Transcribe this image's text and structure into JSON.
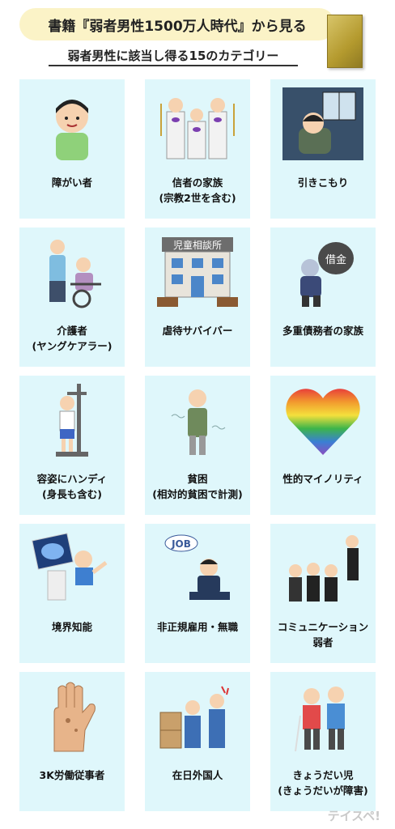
{
  "header": {
    "title": "書籍『弱者男性1500万人時代』から見る",
    "subtitle": "弱者男性に該当し得る15のカテゴリー"
  },
  "categories": [
    {
      "label": "障がい者",
      "icon": "person-smiling-icon"
    },
    {
      "label": "信者の家族\n(宗教2世を含む)",
      "icon": "cult-family-icon"
    },
    {
      "label": "引きこもり",
      "icon": "shut-in-icon"
    },
    {
      "label": "介護者\n(ヤングケアラー)",
      "icon": "caregiver-wheelchair-icon"
    },
    {
      "label": "虐待サバイバー",
      "icon": "child-consultation-center-icon"
    },
    {
      "label": "多重債務者の家族",
      "icon": "debt-burden-icon"
    },
    {
      "label": "容姿にハンディ\n(身長も含む)",
      "icon": "height-measure-icon"
    },
    {
      "label": "貧困\n(相対的貧困で計測)",
      "icon": "poor-man-icon"
    },
    {
      "label": "性的マイノリティ",
      "icon": "rainbow-heart-icon"
    },
    {
      "label": "境界知能",
      "icon": "brain-scan-icon"
    },
    {
      "label": "非正規雇用・無職",
      "icon": "job-lost-icon"
    },
    {
      "label": "コミュニケーション\n弱者",
      "icon": "group-students-icon"
    },
    {
      "label": "3K労働従事者",
      "icon": "rough-hand-icon"
    },
    {
      "label": "在日外国人",
      "icon": "workers-boxes-icon"
    },
    {
      "label": "きょうだい児\n(きょうだいが障害)",
      "icon": "siblings-icon"
    }
  ],
  "illustration_text": {
    "sign": "児童相談所",
    "debt": "借金",
    "job": "JOB"
  },
  "watermark": "テイスペ!"
}
